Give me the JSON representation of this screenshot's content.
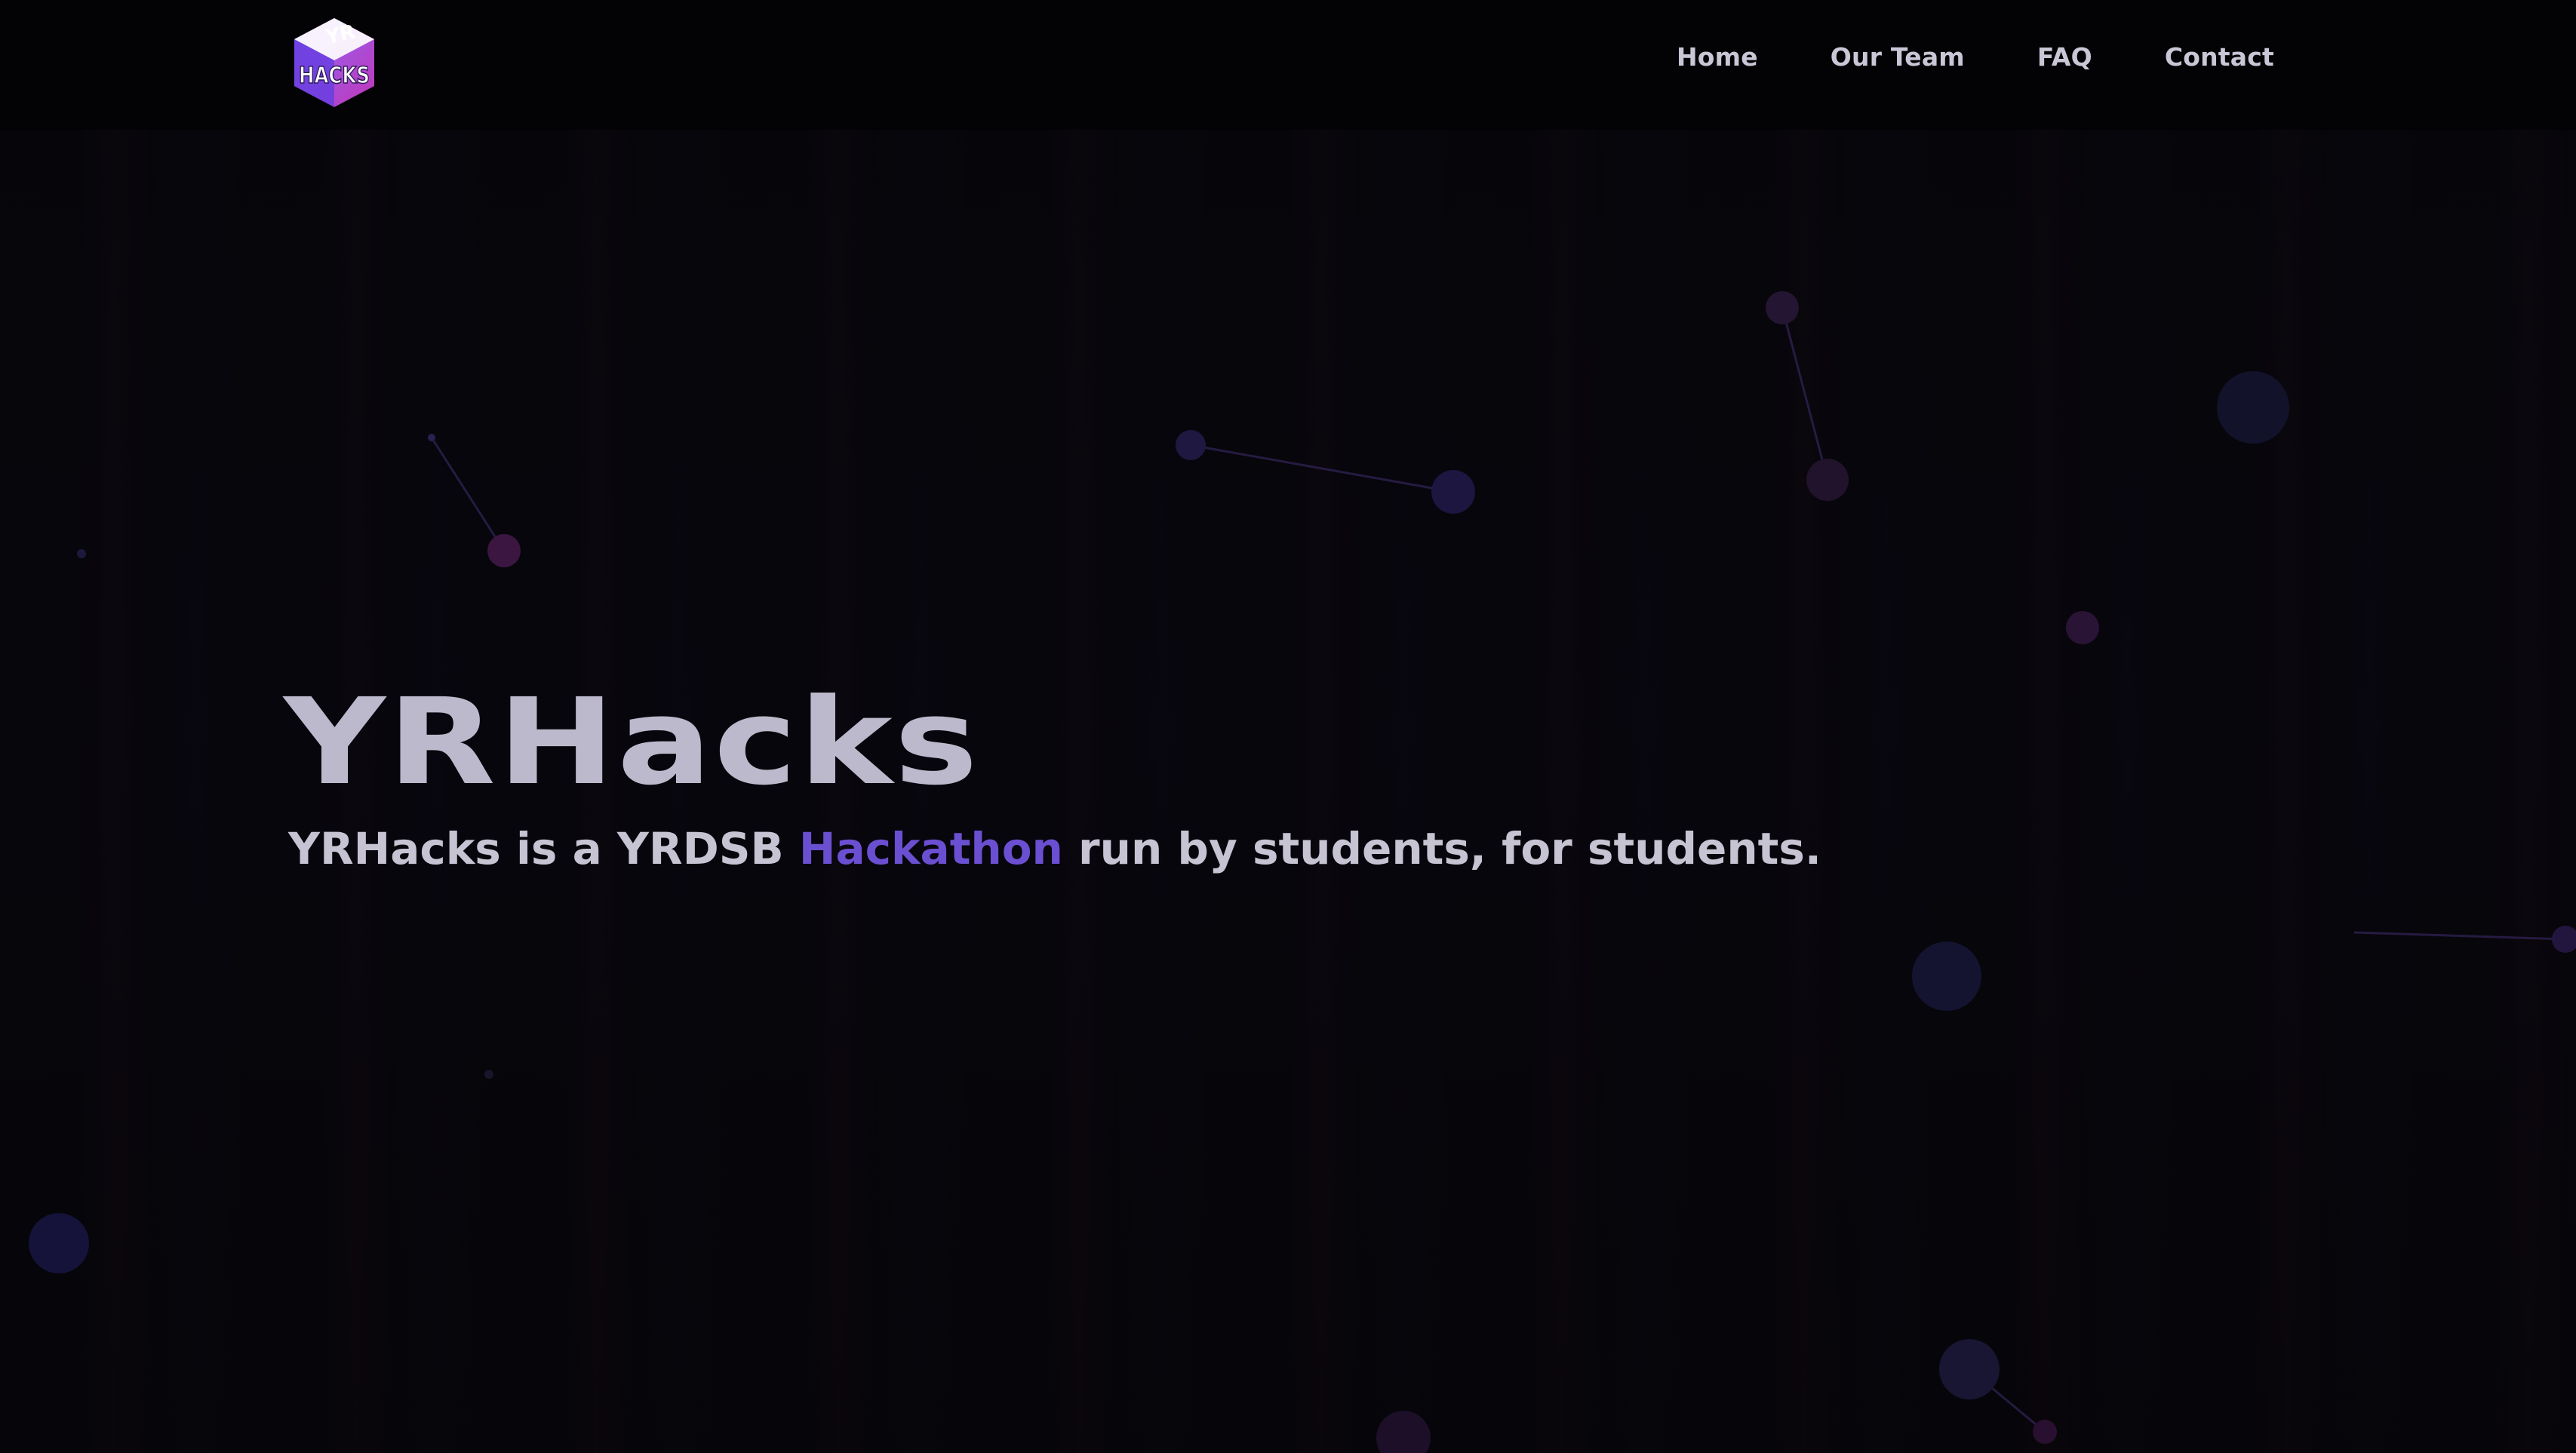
{
  "brand": {
    "logo_icon": "yrhacks-cube-logo",
    "logo_lines": [
      "YR",
      "HACKS"
    ],
    "colors": {
      "accent": "#6b4fd1",
      "background": "#06060b",
      "navbar": "#030305",
      "text": "#c6c3d2"
    }
  },
  "nav": {
    "items": [
      {
        "label": "Home"
      },
      {
        "label": "Our Team"
      },
      {
        "label": "FAQ"
      },
      {
        "label": "Contact"
      }
    ]
  },
  "hero": {
    "title": "YRHacks",
    "subtitle_before": "YRHacks is a YRDSB ",
    "subtitle_accent": "Hackathon",
    "subtitle_after": " run by students, for students."
  }
}
